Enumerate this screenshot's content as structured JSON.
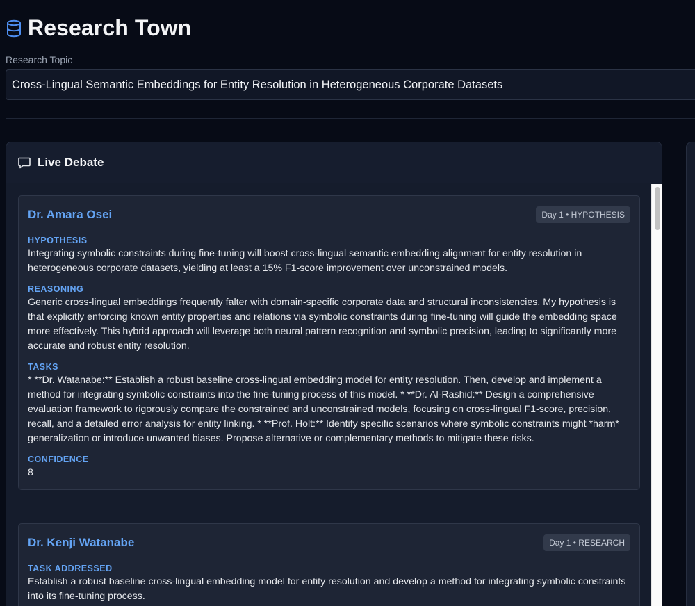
{
  "header": {
    "icon": "database-icon",
    "title": "Research Town"
  },
  "topic": {
    "label": "Research Topic",
    "value": "Cross-Lingual Semantic Embeddings for Entity Resolution in Heterogeneous Corporate Datasets"
  },
  "debate": {
    "icon": "chat-bubble-icon",
    "title": "Live Debate",
    "cards": [
      {
        "agent": "Dr. Amara Osei",
        "badge": "Day 1 • HYPOTHESIS",
        "sections": [
          {
            "label": "HYPOTHESIS",
            "text": "Integrating symbolic constraints during fine-tuning will boost cross-lingual semantic embedding alignment for entity resolution in heterogeneous corporate datasets, yielding at least a 15% F1-score improvement over unconstrained models."
          },
          {
            "label": "REASONING",
            "text": "Generic cross-lingual embeddings frequently falter with domain-specific corporate data and structural inconsistencies. My hypothesis is that explicitly enforcing known entity properties and relations via symbolic constraints during fine-tuning will guide the embedding space more effectively. This hybrid approach will leverage both neural pattern recognition and symbolic precision, leading to significantly more accurate and robust entity resolution."
          },
          {
            "label": "TASKS",
            "text": "* **Dr. Watanabe:** Establish a robust baseline cross-lingual embedding model for entity resolution. Then, develop and implement a method for integrating symbolic constraints into the fine-tuning process of this model. * **Dr. Al-Rashid:** Design a comprehensive evaluation framework to rigorously compare the constrained and unconstrained models, focusing on cross-lingual F1-score, precision, recall, and a detailed error analysis for entity linking. * **Prof. Holt:** Identify specific scenarios where symbolic constraints might *harm* generalization or introduce unwanted biases. Propose alternative or complementary methods to mitigate these risks."
          },
          {
            "label": "CONFIDENCE",
            "text": "8"
          }
        ]
      },
      {
        "agent": "Dr. Kenji Watanabe",
        "badge": "Day 1 • RESEARCH",
        "sections": [
          {
            "label": "TASK ADDRESSED",
            "text": "Establish a robust baseline cross-lingual embedding model for entity resolution and develop a method for integrating symbolic constraints into its fine-tuning process."
          }
        ]
      }
    ]
  }
}
